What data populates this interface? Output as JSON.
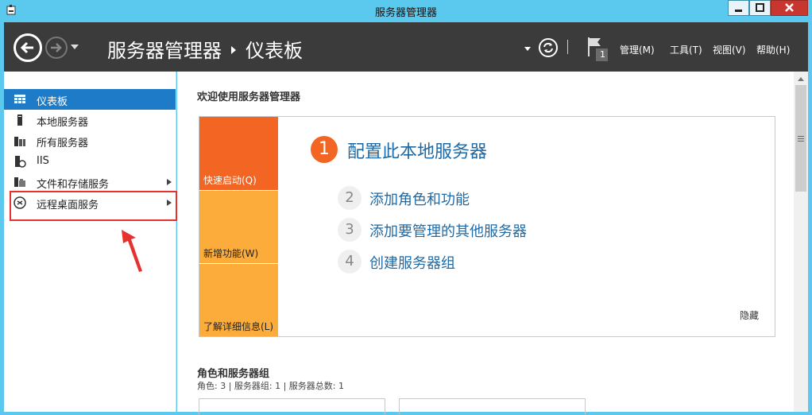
{
  "window": {
    "title": "服务器管理器"
  },
  "header": {
    "breadcrumb_root": "服务器管理器",
    "breadcrumb_current": "仪表板",
    "notification_count": "1",
    "menus": [
      "管理(M)",
      "工具(T)",
      "视图(V)",
      "帮助(H)"
    ]
  },
  "sidebar": {
    "items": [
      {
        "label": "仪表板",
        "icon": "dashboard-grid-icon",
        "active": true
      },
      {
        "label": "本地服务器",
        "icon": "server-icon"
      },
      {
        "label": "所有服务器",
        "icon": "servers-icon"
      },
      {
        "label": "IIS",
        "icon": "iis-icon"
      },
      {
        "label": "文件和存储服务",
        "icon": "file-storage-icon",
        "expandable": true
      },
      {
        "label": "远程桌面服务",
        "icon": "remote-desktop-icon",
        "expandable": true
      }
    ]
  },
  "main": {
    "welcome_title": "欢迎使用服务器管理器",
    "tiles": [
      "快速启动(Q)",
      "新增功能(W)",
      "了解详细信息(L)"
    ],
    "steps": [
      {
        "num": "1",
        "label": "配置此本地服务器"
      },
      {
        "num": "2",
        "label": "添加角色和功能"
      },
      {
        "num": "3",
        "label": "添加要管理的其他服务器"
      },
      {
        "num": "4",
        "label": "创建服务器组"
      }
    ],
    "hide_label": "隐藏",
    "roles_title": "角色和服务器组",
    "roles_summary": "角色: 3 | 服务器组: 1 | 服务器总数: 1"
  },
  "colors": {
    "titlebar": "#5bc8ee",
    "header": "#3b3b3b",
    "active_item": "#1d7bc8",
    "quick_start": "#f26522",
    "tile_secondary": "#fbac3b",
    "link": "#1f6aa5",
    "annotation": "#e6312f"
  }
}
